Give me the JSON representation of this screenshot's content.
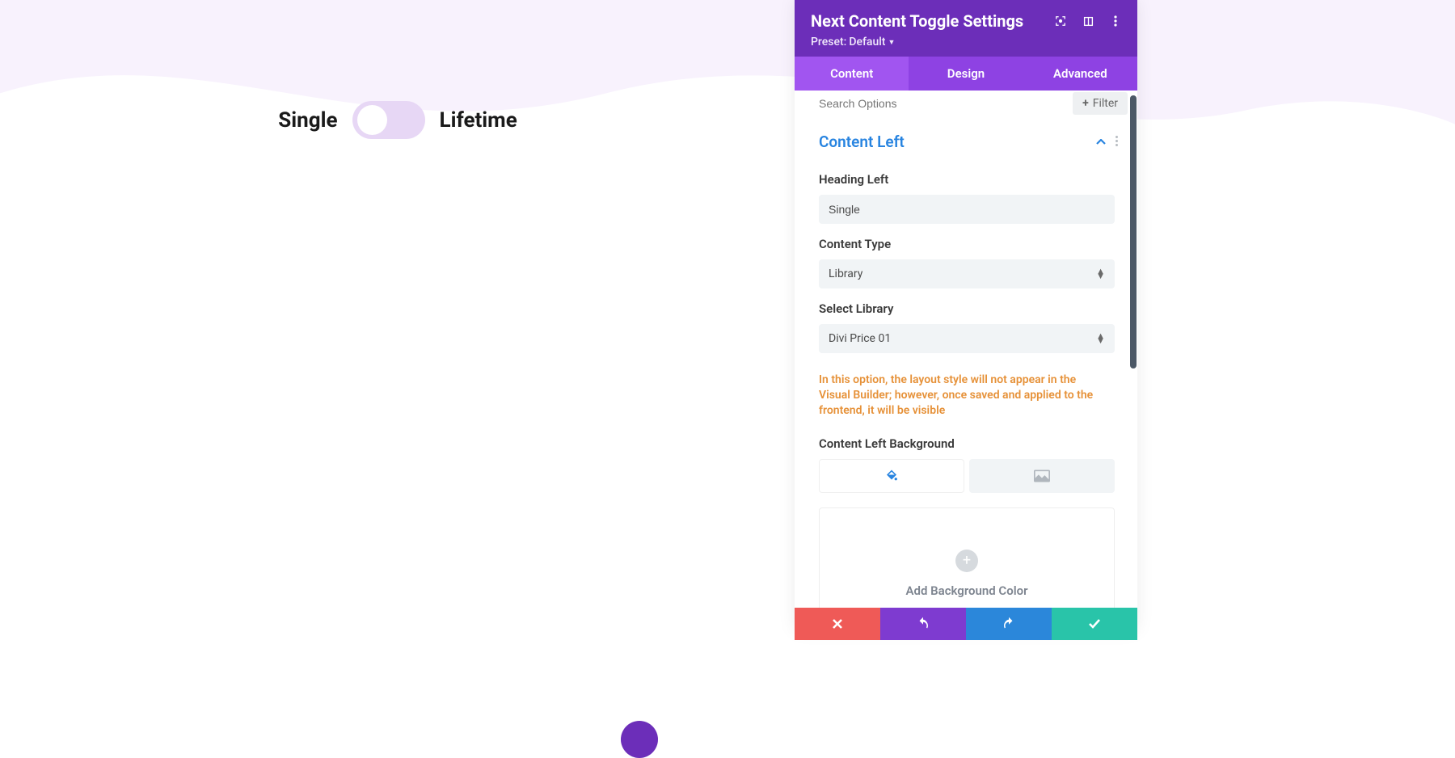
{
  "toggle": {
    "left_label": "Single",
    "right_label": "Lifetime"
  },
  "panel": {
    "title": "Next Content Toggle Settings",
    "preset_label": "Preset:",
    "preset_value": "Default"
  },
  "tabs": {
    "content": "Content",
    "design": "Design",
    "advanced": "Advanced"
  },
  "search": {
    "placeholder": "Search Options",
    "filter_label": "Filter"
  },
  "section": {
    "title": "Content Left"
  },
  "fields": {
    "heading_label": "Heading Left",
    "heading_value": "Single",
    "content_type_label": "Content Type",
    "content_type_value": "Library",
    "select_library_label": "Select Library",
    "select_library_value": "Divi Price 01",
    "warning": "In this option, the layout style will not appear in the Visual Builder; however, once saved and applied to the frontend, it will be visible",
    "bg_label": "Content Left Background",
    "add_bg_label": "Add Background Color"
  }
}
